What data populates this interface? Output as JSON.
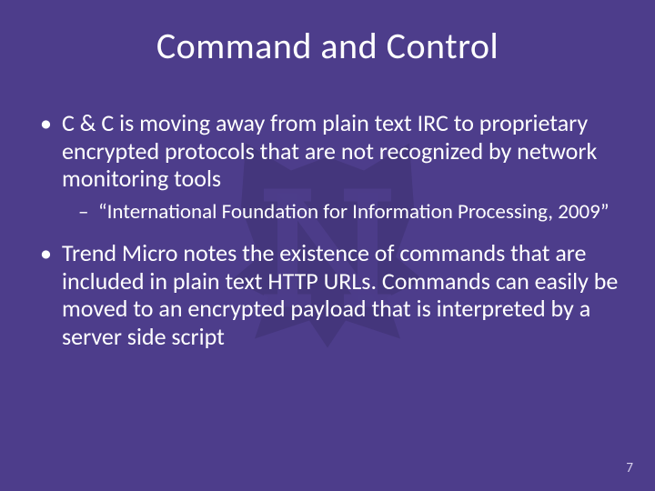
{
  "title": "Command and Control",
  "bullets": {
    "b1": "C & C is moving away from plain text IRC to proprietary encrypted protocols that are not recognized by network monitoring tools",
    "b1_sub": "“International Foundation for Information Processing, 2009”",
    "b2": "Trend Micro notes the existence of commands that are included in plain text HTTP URLs. Commands can easily be moved to an encrypted payload that is interpreted by a server side script"
  },
  "page_number": "7",
  "colors": {
    "background": "#4d3d8b",
    "text": "#ffffff"
  }
}
